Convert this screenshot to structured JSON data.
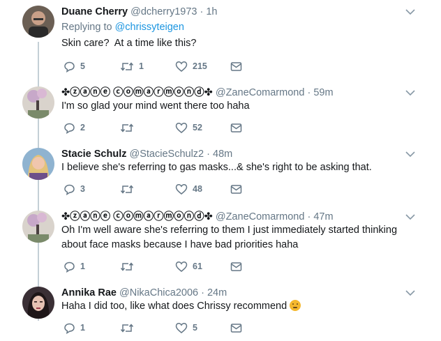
{
  "tweets": [
    {
      "name": "Duane Cherry",
      "handle": "@dcherry1973",
      "time": "1h",
      "replying_prefix": "Replying to",
      "replying_to": "@chrissyteigen",
      "text": [
        "Skin care?  At a time like this?"
      ],
      "replies": "5",
      "retweets": "1",
      "likes": "215"
    },
    {
      "name": "✤ⓩⓐⓝⓔ ⓒⓞⓜⓐⓡⓜⓞⓝⓓ✤",
      "handle": "@ZaneComarmond",
      "time": "59m",
      "text": [
        "I'm so glad your mind went there too haha"
      ],
      "replies": "2",
      "retweets": "",
      "likes": "52"
    },
    {
      "name": "Stacie Schulz",
      "handle": "@StacieSchulz2",
      "time": "48m",
      "text": [
        "I believe she's referring to gas masks...& she's right to be asking that."
      ],
      "replies": "3",
      "retweets": "",
      "likes": "48"
    },
    {
      "name": "✤ⓩⓐⓝⓔ ⓒⓞⓜⓐⓡⓜⓞⓝⓓ✤",
      "handle": "@ZaneComarmond",
      "time": "47m",
      "text": [
        "Oh I'm well aware she's referring to them I just immediately started thinking",
        "about face masks because I have bad priorities haha"
      ],
      "replies": "1",
      "retweets": "",
      "likes": "61"
    },
    {
      "name": "Annika Rae",
      "handle": "@NikaChica2006",
      "time": "24m",
      "text": [
        "Haha I did too, like what does Chrissy recommend"
      ],
      "emoji": "thinking-face-icon",
      "replies": "1",
      "retweets": "",
      "likes": "5"
    }
  ],
  "separator": "·",
  "colors": {
    "text": "#14171a",
    "muted": "#657786",
    "link": "#1b95e0",
    "thread": "#c4cfd6"
  }
}
